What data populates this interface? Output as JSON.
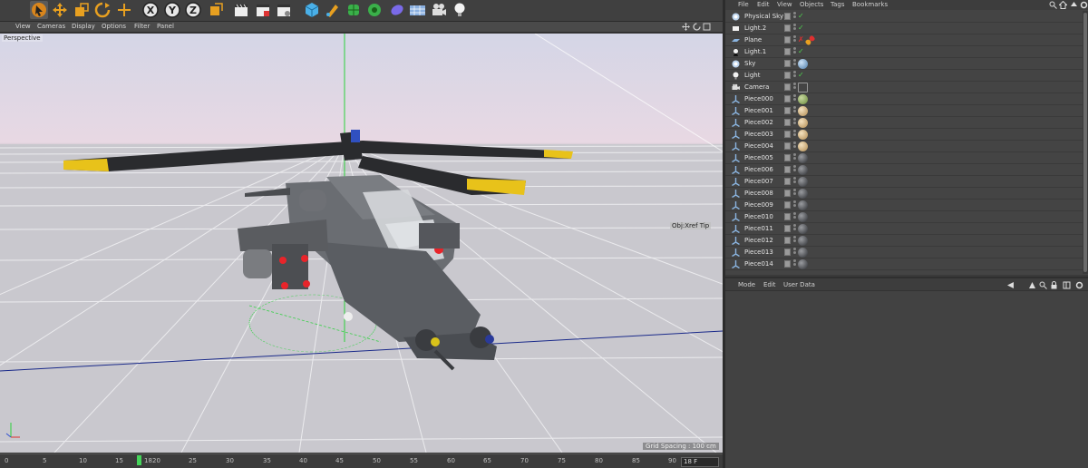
{
  "viewport": {
    "menu": [
      "View",
      "Cameras",
      "Display",
      "Options",
      "Filter",
      "Panel"
    ],
    "label": "Perspective",
    "grid_spacing": "Grid Spacing : 100 cm",
    "overlay_text": "Obj:Xref Tip"
  },
  "toolbar": {
    "icons": [
      "select-tool-icon",
      "move-icon",
      "scale-icon",
      "rotate-icon",
      "add-icon",
      "x-axis-icon",
      "y-axis-icon",
      "z-axis-icon",
      "coordinate-system-icon",
      "render-view-icon",
      "render-picture-icon",
      "edit-render-settings-icon",
      "cube-icon",
      "pen-icon",
      "subdivision-icon",
      "array-icon",
      "deformer-icon",
      "floor-icon",
      "camera-icon",
      "light-icon"
    ]
  },
  "timeline": {
    "ticks": [
      "0",
      "5",
      "10",
      "15",
      "18",
      "20",
      "25",
      "30",
      "35",
      "40",
      "45",
      "50",
      "55",
      "60",
      "65",
      "70",
      "75",
      "80",
      "85",
      "90"
    ],
    "current_frame": "18",
    "frame_field": "18 F"
  },
  "object_manager": {
    "menu": [
      "File",
      "Edit",
      "View",
      "Objects",
      "Tags",
      "Bookmarks"
    ],
    "objects": [
      {
        "name": "Physical Sky",
        "icon": "sky-icon",
        "check": "✓",
        "tag": ""
      },
      {
        "name": "Light.2",
        "icon": "area-light-icon",
        "check": "✓",
        "tag": ""
      },
      {
        "name": "Plane",
        "icon": "plane-icon",
        "check": "✗",
        "tag": "dots"
      },
      {
        "name": "Light.1",
        "icon": "spot-light-icon",
        "check": "✓",
        "tag": ""
      },
      {
        "name": "Sky",
        "icon": "sky-icon",
        "check": "",
        "tag": "sky"
      },
      {
        "name": "Light",
        "icon": "light-bulb-icon",
        "check": "✓",
        "tag": ""
      },
      {
        "name": "Camera",
        "icon": "camera-icon",
        "check": "",
        "tag": "target"
      },
      {
        "name": "Piece000",
        "icon": "null-icon",
        "check": "",
        "tag": "green"
      },
      {
        "name": "Piece001",
        "icon": "null-icon",
        "check": "",
        "tag": "tan"
      },
      {
        "name": "Piece002",
        "icon": "null-icon",
        "check": "",
        "tag": "tan"
      },
      {
        "name": "Piece003",
        "icon": "null-icon",
        "check": "",
        "tag": "tan"
      },
      {
        "name": "Piece004",
        "icon": "null-icon",
        "check": "",
        "tag": "tan"
      },
      {
        "name": "Piece005",
        "icon": "null-icon",
        "check": "",
        "tag": "dark"
      },
      {
        "name": "Piece006",
        "icon": "null-icon",
        "check": "",
        "tag": "dark"
      },
      {
        "name": "Piece007",
        "icon": "null-icon",
        "check": "",
        "tag": "dark"
      },
      {
        "name": "Piece008",
        "icon": "null-icon",
        "check": "",
        "tag": "dark"
      },
      {
        "name": "Piece009",
        "icon": "null-icon",
        "check": "",
        "tag": "dark"
      },
      {
        "name": "Piece010",
        "icon": "null-icon",
        "check": "",
        "tag": "dark"
      },
      {
        "name": "Piece011",
        "icon": "null-icon",
        "check": "",
        "tag": "dark"
      },
      {
        "name": "Piece012",
        "icon": "null-icon",
        "check": "",
        "tag": "dark"
      },
      {
        "name": "Piece013",
        "icon": "null-icon",
        "check": "",
        "tag": "dark"
      },
      {
        "name": "Piece014",
        "icon": "null-icon",
        "check": "",
        "tag": "dark"
      }
    ]
  },
  "attributes": {
    "menu": [
      "Mode",
      "Edit",
      "User Data"
    ]
  },
  "colors": {
    "accent_orange": "#e8a020",
    "check_green": "#4ed04e",
    "cross_red": "#e03030",
    "playhead": "#45d45a"
  }
}
